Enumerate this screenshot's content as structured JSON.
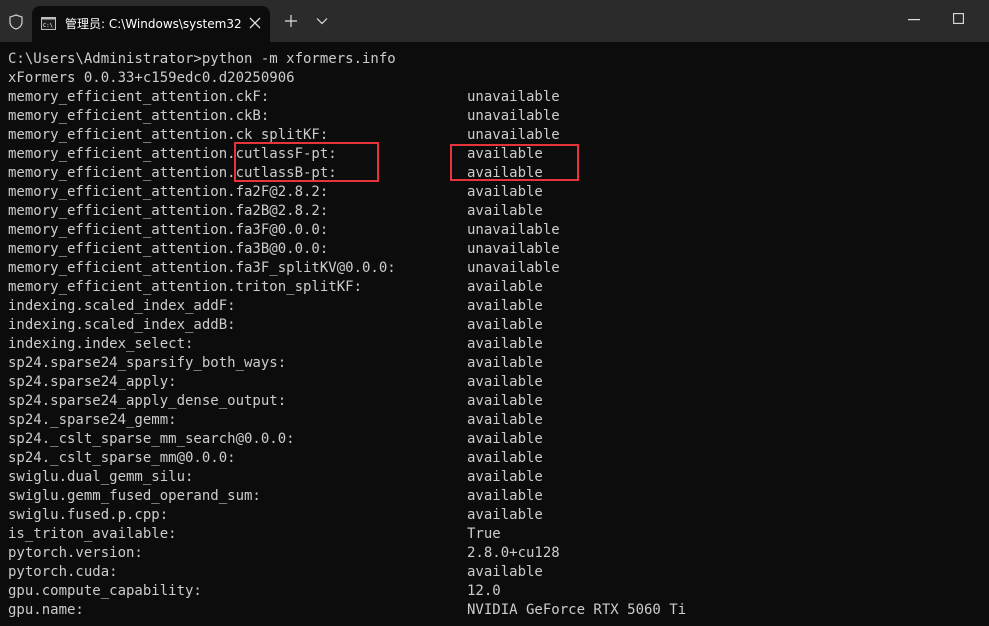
{
  "window": {
    "tab_title": "管理员: C:\\Windows\\system32"
  },
  "terminal": {
    "command": "C:\\Users\\Administrator>python -m xformers.info",
    "version": "xFormers 0.0.33+c159edc0.d20250906",
    "rows": [
      {
        "key": "memory_efficient_attention.ckF:",
        "value": "unavailable"
      },
      {
        "key": "memory_efficient_attention.ckB:",
        "value": "unavailable"
      },
      {
        "key": "memory_efficient_attention.ck_splitKF:",
        "value": "unavailable"
      },
      {
        "key": "memory_efficient_attention.cutlassF-pt:",
        "value": "available"
      },
      {
        "key": "memory_efficient_attention.cutlassB-pt:",
        "value": "available"
      },
      {
        "key": "memory_efficient_attention.fa2F@2.8.2:",
        "value": "available"
      },
      {
        "key": "memory_efficient_attention.fa2B@2.8.2:",
        "value": "available"
      },
      {
        "key": "memory_efficient_attention.fa3F@0.0.0:",
        "value": "unavailable"
      },
      {
        "key": "memory_efficient_attention.fa3B@0.0.0:",
        "value": "unavailable"
      },
      {
        "key": "memory_efficient_attention.fa3F_splitKV@0.0.0:",
        "value": "unavailable"
      },
      {
        "key": "memory_efficient_attention.triton_splitKF:",
        "value": "available"
      },
      {
        "key": "indexing.scaled_index_addF:",
        "value": "available"
      },
      {
        "key": "indexing.scaled_index_addB:",
        "value": "available"
      },
      {
        "key": "indexing.index_select:",
        "value": "available"
      },
      {
        "key": "sp24.sparse24_sparsify_both_ways:",
        "value": "available"
      },
      {
        "key": "sp24.sparse24_apply:",
        "value": "available"
      },
      {
        "key": "sp24.sparse24_apply_dense_output:",
        "value": "available"
      },
      {
        "key": "sp24._sparse24_gemm:",
        "value": "available"
      },
      {
        "key": "sp24._cslt_sparse_mm_search@0.0.0:",
        "value": "available"
      },
      {
        "key": "sp24._cslt_sparse_mm@0.0.0:",
        "value": "available"
      },
      {
        "key": "swiglu.dual_gemm_silu:",
        "value": "available"
      },
      {
        "key": "swiglu.gemm_fused_operand_sum:",
        "value": "available"
      },
      {
        "key": "swiglu.fused.p.cpp:",
        "value": "available"
      },
      {
        "key": "is_triton_available:",
        "value": "True"
      },
      {
        "key": "pytorch.version:",
        "value": "2.8.0+cu128"
      },
      {
        "key": "pytorch.cuda:",
        "value": "available"
      },
      {
        "key": "gpu.compute_capability:",
        "value": "12.0"
      },
      {
        "key": "gpu.name:",
        "value": "NVIDIA GeForce RTX 5060 Ti"
      }
    ]
  },
  "colors": {
    "titlebar": "#2b2b2b",
    "terminal_bg": "#0c0c0c",
    "terminal_text": "#cccccc",
    "highlight": "#e8333a"
  }
}
